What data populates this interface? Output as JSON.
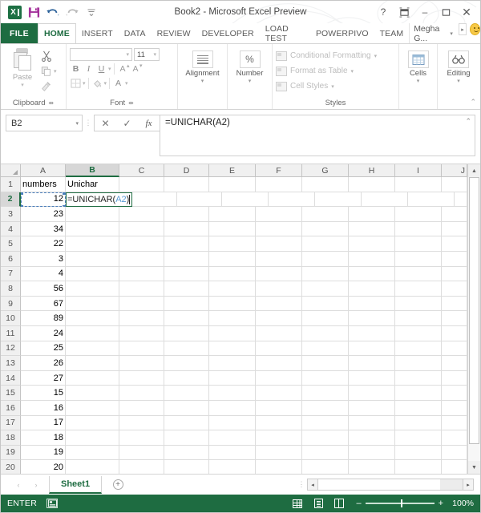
{
  "titlebar": {
    "document_title": "Book2 - Microsoft Excel Preview",
    "qat": [
      {
        "name": "excel-logo",
        "label": "X"
      },
      {
        "name": "save-icon",
        "label": "Save"
      },
      {
        "name": "undo-icon",
        "label": "Undo"
      },
      {
        "name": "redo-icon",
        "label": "Redo"
      },
      {
        "name": "customize-qat-icon",
        "label": "Customize Quick Access Toolbar"
      }
    ],
    "window_buttons": {
      "help": "?",
      "ribbon_options": "⌧",
      "minimize": "–",
      "maximize": "☐",
      "close": "✕"
    }
  },
  "ribbon_tabs": {
    "file": "FILE",
    "tabs": [
      {
        "label": "HOME",
        "active": true
      },
      {
        "label": "INSERT",
        "active": false
      },
      {
        "label": "DATA",
        "active": false
      },
      {
        "label": "REVIEW",
        "active": false
      },
      {
        "label": "DEVELOPER",
        "active": false
      },
      {
        "label": "LOAD TEST",
        "active": false
      },
      {
        "label": "POWERPIVO",
        "active": false
      },
      {
        "label": "TEAM",
        "active": false
      }
    ],
    "account": "Megha G...",
    "account_caret": "▾",
    "mini_button": "▸",
    "smiley": "smiley-face"
  },
  "ribbon": {
    "clipboard": {
      "title": "Clipboard",
      "paste_label": "Paste",
      "paste_caret": "▾",
      "items": [
        {
          "name": "cut-icon",
          "label": "Cut"
        },
        {
          "name": "copy-icon",
          "label": "Copy"
        },
        {
          "name": "format-painter-icon",
          "label": "Format Painter"
        }
      ],
      "dialog_launcher": "⬌"
    },
    "font": {
      "title": "Font",
      "font_name_value": "",
      "font_size_value": "11",
      "bold": "B",
      "italic": "I",
      "underline": "U",
      "grow_font": "A",
      "shrink_font": "A",
      "borders": "borders-icon",
      "fill_color": "A",
      "font_color": "A",
      "caret": "▾",
      "dialog_launcher": "⬌"
    },
    "alignment": {
      "title": "Alignment",
      "label": "Alignment",
      "caret": "▾"
    },
    "number": {
      "title": "Number",
      "label": "Number",
      "symbol": "%",
      "caret": "▾"
    },
    "styles": {
      "title": "Styles",
      "items": [
        {
          "label": "Conditional Formatting",
          "caret": "▾"
        },
        {
          "label": "Format as Table",
          "caret": "▾"
        },
        {
          "label": "Cell Styles",
          "caret": "▾"
        }
      ]
    },
    "cells": {
      "label": "Cells",
      "caret": "▾"
    },
    "editing": {
      "label": "Editing",
      "caret": "▾"
    },
    "collapse_arrow": "⌃"
  },
  "formula_bar": {
    "name_box_value": "B2",
    "name_box_caret": "▾",
    "dots": "⋮",
    "cancel": "✕",
    "enter": "✓",
    "insert_function": "fx",
    "formula_value": "=UNICHAR(A2)",
    "expand_caret": "⌃"
  },
  "grid": {
    "corner": "",
    "columns": [
      "A",
      "B",
      "C",
      "D",
      "E",
      "F",
      "G",
      "H",
      "I",
      "J"
    ],
    "selected_column": "B",
    "selected_row": "2",
    "rows": [
      {
        "num": "1",
        "a": "numbers",
        "b": "Unichar"
      },
      {
        "num": "2",
        "a": "12",
        "b": ""
      },
      {
        "num": "3",
        "a": "23",
        "b": ""
      },
      {
        "num": "4",
        "a": "34",
        "b": ""
      },
      {
        "num": "5",
        "a": "22",
        "b": ""
      },
      {
        "num": "6",
        "a": "3",
        "b": ""
      },
      {
        "num": "7",
        "a": "4",
        "b": ""
      },
      {
        "num": "8",
        "a": "56",
        "b": ""
      },
      {
        "num": "9",
        "a": "67",
        "b": ""
      },
      {
        "num": "10",
        "a": "89",
        "b": ""
      },
      {
        "num": "11",
        "a": "24",
        "b": ""
      },
      {
        "num": "12",
        "a": "25",
        "b": ""
      },
      {
        "num": "13",
        "a": "26",
        "b": ""
      },
      {
        "num": "14",
        "a": "27",
        "b": ""
      },
      {
        "num": "15",
        "a": "15",
        "b": ""
      },
      {
        "num": "16",
        "a": "16",
        "b": ""
      },
      {
        "num": "17",
        "a": "17",
        "b": ""
      },
      {
        "num": "18",
        "a": "18",
        "b": ""
      },
      {
        "num": "19",
        "a": "19",
        "b": ""
      },
      {
        "num": "20",
        "a": "20",
        "b": ""
      }
    ],
    "editing_cell": {
      "prefix": "=UNICHAR(",
      "reference": "A2",
      "suffix": ")"
    },
    "scroll_up": "▲",
    "scroll_down": "▼"
  },
  "sheet_tabs": {
    "prev": "‹",
    "next": "›",
    "sheets": [
      {
        "label": "Sheet1",
        "active": true
      }
    ],
    "add_sheet": "+",
    "dots": "⋮",
    "hscroll_left": "◂",
    "hscroll_right": "▸"
  },
  "status_bar": {
    "mode": "ENTER",
    "record_macro": "record-macro-icon",
    "views": [
      {
        "name": "normal-view-button"
      },
      {
        "name": "page-layout-view-button"
      },
      {
        "name": "page-break-preview-button"
      }
    ],
    "zoom_out": "–",
    "zoom_in": "+",
    "zoom_level": "100%"
  },
  "colors": {
    "excel_green": "#1e6c41",
    "ref_blue": "#5b9bd5",
    "header_gray": "#f0f0f0"
  }
}
